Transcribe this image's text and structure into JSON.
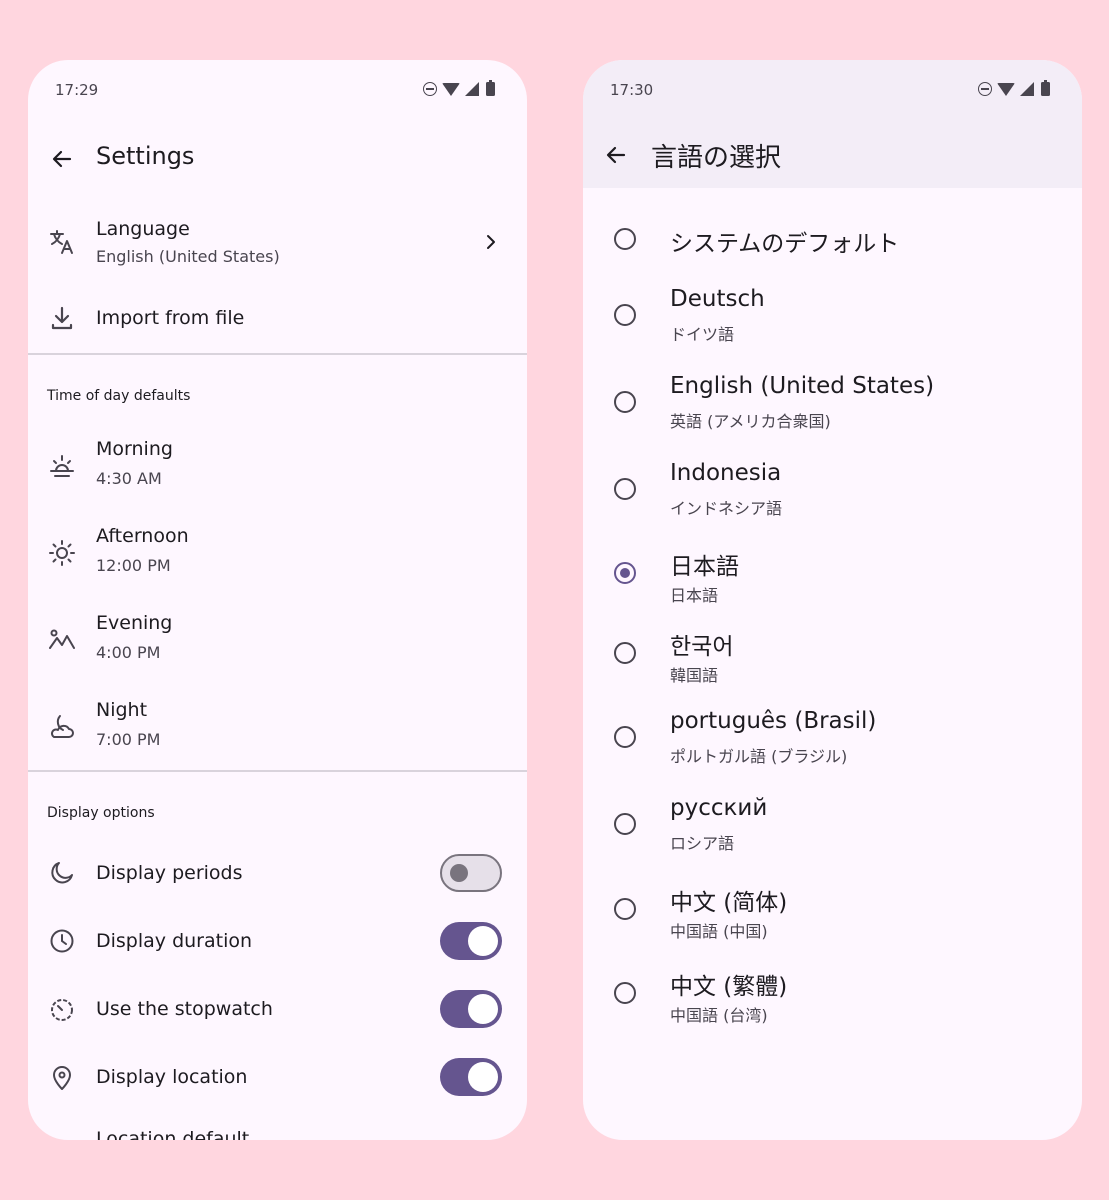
{
  "left": {
    "status_time": "17:29",
    "title": "Settings",
    "language": {
      "label": "Language",
      "value": "English (United States)"
    },
    "import_label": "Import from file",
    "time_section": "Time of day defaults",
    "times": [
      {
        "label": "Morning",
        "value": "4:30 AM",
        "icon": "sunrise-icon"
      },
      {
        "label": "Afternoon",
        "value": "12:00 PM",
        "icon": "sun-icon"
      },
      {
        "label": "Evening",
        "value": "4:00 PM",
        "icon": "landscape-icon"
      },
      {
        "label": "Night",
        "value": "7:00 PM",
        "icon": "moon-cloud-icon"
      }
    ],
    "display_section": "Display options",
    "toggles": [
      {
        "label": "Display periods",
        "on": false
      },
      {
        "label": "Display duration",
        "on": true
      },
      {
        "label": "Use the stopwatch",
        "on": true
      },
      {
        "label": "Display location",
        "on": true
      }
    ],
    "cut_item": "Location default"
  },
  "right": {
    "status_time": "17:30",
    "title": "言語の選択",
    "languages": [
      {
        "name": "システムのデフォルト",
        "native": "",
        "selected": false
      },
      {
        "name": "Deutsch",
        "native": "ドイツ語",
        "selected": false
      },
      {
        "name": "English (United States)",
        "native": "英語 (アメリカ合衆国)",
        "selected": false
      },
      {
        "name": "Indonesia",
        "native": "インドネシア語",
        "selected": false
      },
      {
        "name": "日本語",
        "native": "日本語",
        "selected": true
      },
      {
        "name": "한국어",
        "native": "韓国語",
        "selected": false
      },
      {
        "name": "português (Brasil)",
        "native": "ポルトガル語 (ブラジル)",
        "selected": false
      },
      {
        "name": "русский",
        "native": "ロシア語",
        "selected": false
      },
      {
        "name": "中文 (简体)",
        "native": "中国語 (中国)",
        "selected": false
      },
      {
        "name": "中文 (繁體)",
        "native": "中国語 (台湾)",
        "selected": false
      }
    ]
  },
  "colors": {
    "background": "#FFD6DF",
    "surface": "#FEF7FF",
    "header": "#F3EDF7",
    "accent": "#65558F"
  }
}
